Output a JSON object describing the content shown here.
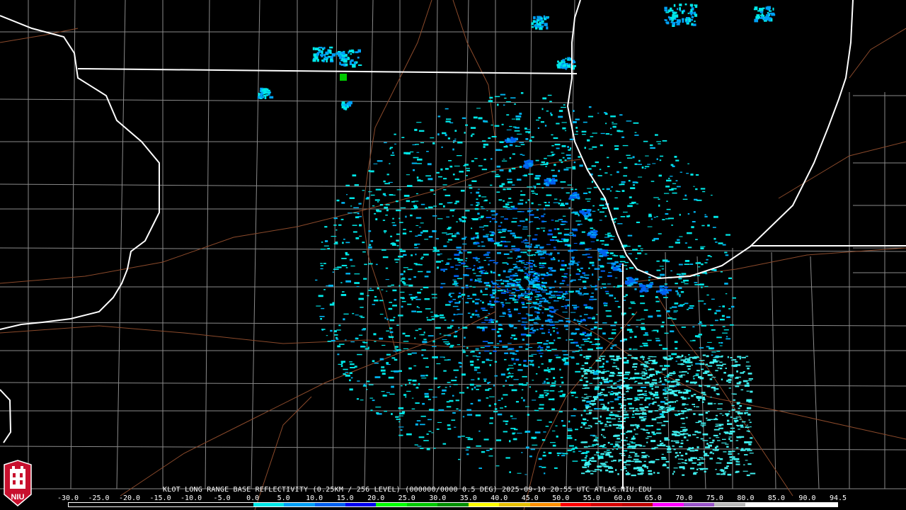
{
  "caption": "KLOT LONG RANGE BASE REFLECTIVITY (0.25KM / 256 LEVEL) (000000/0000 0.5 DEG) 2025-09-10 20:55 UTC  ATLAS.NIU.EDU",
  "logo_text": "NIU",
  "scale": {
    "labels": [
      "-30.0",
      "-25.0",
      "-20.0",
      "-15.0",
      "-10.0",
      "-5.0",
      "0.0",
      "5.0",
      "10.0",
      "15.0",
      "20.0",
      "25.0",
      "30.0",
      "35.0",
      "40.0",
      "45.0",
      "50.0",
      "55.0",
      "60.0",
      "65.0",
      "70.0",
      "75.0",
      "80.0",
      "85.0",
      "90.0",
      "94.5"
    ],
    "colors": [
      "#000000",
      "#000000",
      "#000000",
      "#000000",
      "#000000",
      "#000000",
      "#00e8e8",
      "#00a0f6",
      "#0060f0",
      "#0000f0",
      "#00ff00",
      "#00c800",
      "#009000",
      "#ffff00",
      "#e7c000",
      "#ff9000",
      "#ff0000",
      "#d60000",
      "#c00000",
      "#ff00ff",
      "#9955c9",
      "#bbbbbb",
      "#ffffff",
      "#ffffff",
      "#ffffff"
    ]
  },
  "colors": {
    "background": "#000000",
    "state_border": "#ffffff",
    "county_border": "#8a8a8a",
    "highway": "#8b4a2b",
    "radar_site": "#000000"
  }
}
